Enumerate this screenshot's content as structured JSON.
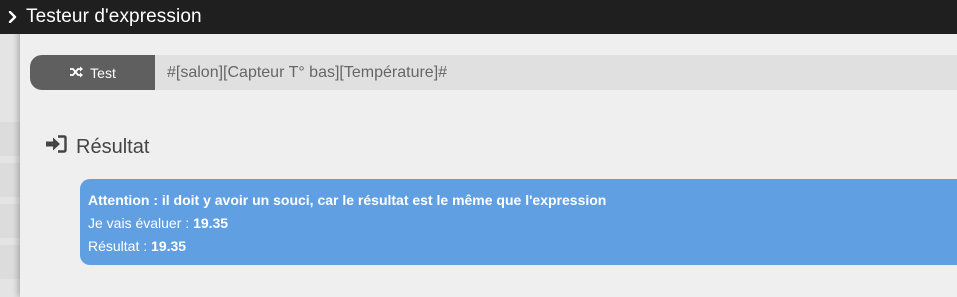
{
  "modal": {
    "title": "Testeur d'expression"
  },
  "test_bar": {
    "button_label": "Test",
    "expression_value": "#[salon][Capteur T° bas][Température]#"
  },
  "result": {
    "heading": "Résultat",
    "warning": "Attention : il doit y avoir un souci, car le résultat est le même que l'expression",
    "evaluate_label": "Je vais évaluer : ",
    "evaluate_value": "19.35",
    "result_label": "Résultat : ",
    "result_value": "19.35"
  },
  "colors": {
    "titlebar": "#1f1f1f",
    "button": "#5f5f5f",
    "alert": "#619fe3",
    "body": "#efeff0"
  }
}
